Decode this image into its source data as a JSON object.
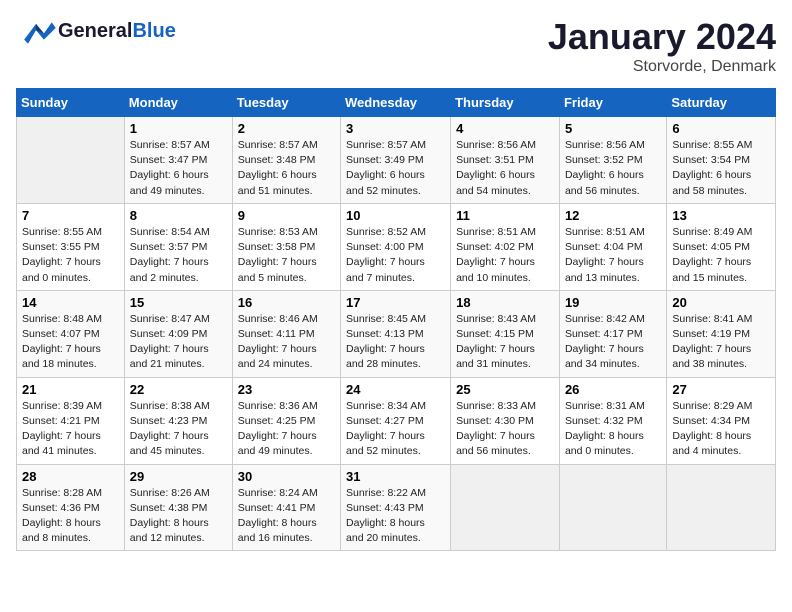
{
  "header": {
    "logo_line1": "General",
    "logo_line2": "Blue",
    "title": "January 2024",
    "subtitle": "Storvorde, Denmark"
  },
  "columns": [
    "Sunday",
    "Monday",
    "Tuesday",
    "Wednesday",
    "Thursday",
    "Friday",
    "Saturday"
  ],
  "weeks": [
    [
      {
        "day": "",
        "content": ""
      },
      {
        "day": "1",
        "content": "Sunrise: 8:57 AM\nSunset: 3:47 PM\nDaylight: 6 hours\nand 49 minutes."
      },
      {
        "day": "2",
        "content": "Sunrise: 8:57 AM\nSunset: 3:48 PM\nDaylight: 6 hours\nand 51 minutes."
      },
      {
        "day": "3",
        "content": "Sunrise: 8:57 AM\nSunset: 3:49 PM\nDaylight: 6 hours\nand 52 minutes."
      },
      {
        "day": "4",
        "content": "Sunrise: 8:56 AM\nSunset: 3:51 PM\nDaylight: 6 hours\nand 54 minutes."
      },
      {
        "day": "5",
        "content": "Sunrise: 8:56 AM\nSunset: 3:52 PM\nDaylight: 6 hours\nand 56 minutes."
      },
      {
        "day": "6",
        "content": "Sunrise: 8:55 AM\nSunset: 3:54 PM\nDaylight: 6 hours\nand 58 minutes."
      }
    ],
    [
      {
        "day": "7",
        "content": "Sunrise: 8:55 AM\nSunset: 3:55 PM\nDaylight: 7 hours\nand 0 minutes."
      },
      {
        "day": "8",
        "content": "Sunrise: 8:54 AM\nSunset: 3:57 PM\nDaylight: 7 hours\nand 2 minutes."
      },
      {
        "day": "9",
        "content": "Sunrise: 8:53 AM\nSunset: 3:58 PM\nDaylight: 7 hours\nand 5 minutes."
      },
      {
        "day": "10",
        "content": "Sunrise: 8:52 AM\nSunset: 4:00 PM\nDaylight: 7 hours\nand 7 minutes."
      },
      {
        "day": "11",
        "content": "Sunrise: 8:51 AM\nSunset: 4:02 PM\nDaylight: 7 hours\nand 10 minutes."
      },
      {
        "day": "12",
        "content": "Sunrise: 8:51 AM\nSunset: 4:04 PM\nDaylight: 7 hours\nand 13 minutes."
      },
      {
        "day": "13",
        "content": "Sunrise: 8:49 AM\nSunset: 4:05 PM\nDaylight: 7 hours\nand 15 minutes."
      }
    ],
    [
      {
        "day": "14",
        "content": "Sunrise: 8:48 AM\nSunset: 4:07 PM\nDaylight: 7 hours\nand 18 minutes."
      },
      {
        "day": "15",
        "content": "Sunrise: 8:47 AM\nSunset: 4:09 PM\nDaylight: 7 hours\nand 21 minutes."
      },
      {
        "day": "16",
        "content": "Sunrise: 8:46 AM\nSunset: 4:11 PM\nDaylight: 7 hours\nand 24 minutes."
      },
      {
        "day": "17",
        "content": "Sunrise: 8:45 AM\nSunset: 4:13 PM\nDaylight: 7 hours\nand 28 minutes."
      },
      {
        "day": "18",
        "content": "Sunrise: 8:43 AM\nSunset: 4:15 PM\nDaylight: 7 hours\nand 31 minutes."
      },
      {
        "day": "19",
        "content": "Sunrise: 8:42 AM\nSunset: 4:17 PM\nDaylight: 7 hours\nand 34 minutes."
      },
      {
        "day": "20",
        "content": "Sunrise: 8:41 AM\nSunset: 4:19 PM\nDaylight: 7 hours\nand 38 minutes."
      }
    ],
    [
      {
        "day": "21",
        "content": "Sunrise: 8:39 AM\nSunset: 4:21 PM\nDaylight: 7 hours\nand 41 minutes."
      },
      {
        "day": "22",
        "content": "Sunrise: 8:38 AM\nSunset: 4:23 PM\nDaylight: 7 hours\nand 45 minutes."
      },
      {
        "day": "23",
        "content": "Sunrise: 8:36 AM\nSunset: 4:25 PM\nDaylight: 7 hours\nand 49 minutes."
      },
      {
        "day": "24",
        "content": "Sunrise: 8:34 AM\nSunset: 4:27 PM\nDaylight: 7 hours\nand 52 minutes."
      },
      {
        "day": "25",
        "content": "Sunrise: 8:33 AM\nSunset: 4:30 PM\nDaylight: 7 hours\nand 56 minutes."
      },
      {
        "day": "26",
        "content": "Sunrise: 8:31 AM\nSunset: 4:32 PM\nDaylight: 8 hours\nand 0 minutes."
      },
      {
        "day": "27",
        "content": "Sunrise: 8:29 AM\nSunset: 4:34 PM\nDaylight: 8 hours\nand 4 minutes."
      }
    ],
    [
      {
        "day": "28",
        "content": "Sunrise: 8:28 AM\nSunset: 4:36 PM\nDaylight: 8 hours\nand 8 minutes."
      },
      {
        "day": "29",
        "content": "Sunrise: 8:26 AM\nSunset: 4:38 PM\nDaylight: 8 hours\nand 12 minutes."
      },
      {
        "day": "30",
        "content": "Sunrise: 8:24 AM\nSunset: 4:41 PM\nDaylight: 8 hours\nand 16 minutes."
      },
      {
        "day": "31",
        "content": "Sunrise: 8:22 AM\nSunset: 4:43 PM\nDaylight: 8 hours\nand 20 minutes."
      },
      {
        "day": "",
        "content": ""
      },
      {
        "day": "",
        "content": ""
      },
      {
        "day": "",
        "content": ""
      }
    ]
  ]
}
